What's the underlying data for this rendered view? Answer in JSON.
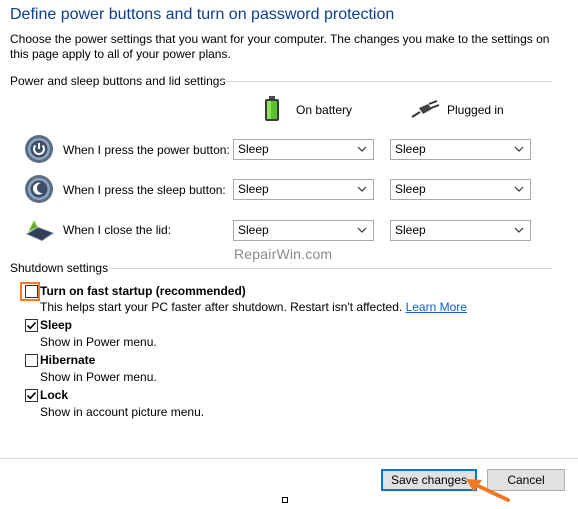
{
  "header": {
    "title": "Define power buttons and turn on password protection",
    "description": "Choose the power settings that you want for your computer. The changes you make to the settings on this page apply to all of your power plans."
  },
  "power_section": {
    "title": "Power and sleep buttons and lid settings",
    "columns": {
      "on_battery": "On battery",
      "plugged_in": "Plugged in"
    },
    "rows": [
      {
        "label": "When I press the power button:",
        "on_battery": "Sleep",
        "plugged_in": "Sleep",
        "icon": "power-button-icon"
      },
      {
        "label": "When I press the sleep button:",
        "on_battery": "Sleep",
        "plugged_in": "Sleep",
        "icon": "sleep-button-icon"
      },
      {
        "label": "When I close the lid:",
        "on_battery": "Sleep",
        "plugged_in": "Sleep",
        "icon": "laptop-lid-icon"
      }
    ]
  },
  "watermark": "RepairWin.com",
  "shutdown_section": {
    "title": "Shutdown settings",
    "items": [
      {
        "label": "Turn on fast startup (recommended)",
        "description": "This helps start your PC faster after shutdown. Restart isn't affected. ",
        "link": "Learn More",
        "checked": false
      },
      {
        "label": "Sleep",
        "description": "Show in Power menu.",
        "checked": true
      },
      {
        "label": "Hibernate",
        "description": "Show in Power menu.",
        "checked": false
      },
      {
        "label": "Lock",
        "description": "Show in account picture menu.",
        "checked": true
      }
    ]
  },
  "footer": {
    "save_label": "Save changes",
    "cancel_label": "Cancel"
  },
  "colors": {
    "title": "#0e3f8c",
    "link": "#0b63c5",
    "focus_outline": "#ff7a1f",
    "arrow": "#f07a22"
  }
}
